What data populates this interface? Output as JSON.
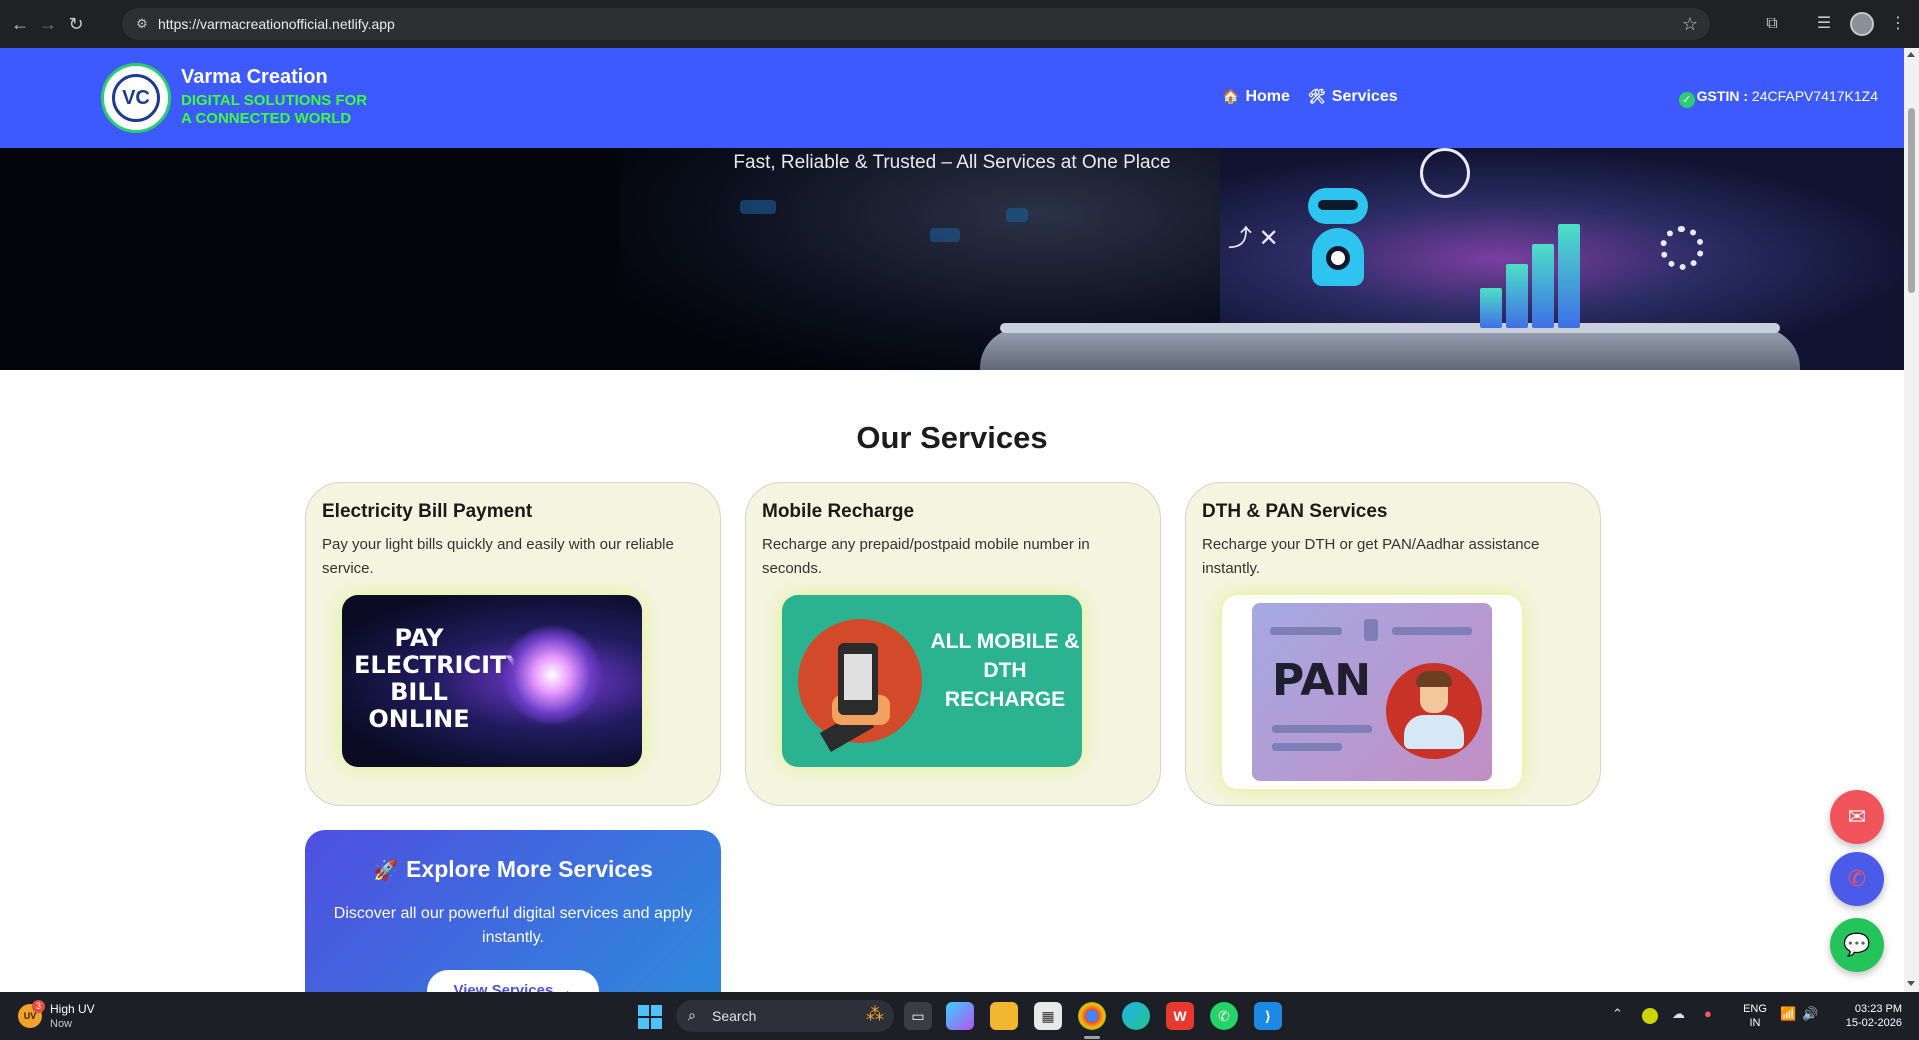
{
  "browser": {
    "url": "https://varmacreationofficial.netlify.app",
    "back_icon": "←",
    "forward_icon": "→",
    "reload_icon": "↻"
  },
  "header": {
    "logo_text": "VC",
    "brand_name": "Varma Creation",
    "tagline_line1": "DIGITAL SOLUTIONS FOR",
    "tagline_line2": "A CONNECTED WORLD",
    "nav": [
      {
        "label": "Home",
        "icon": "home-icon",
        "glyph": "🏠"
      },
      {
        "label": "Services",
        "icon": "tools-icon",
        "glyph": "🛠"
      }
    ],
    "gstin_label": "GSTIN :",
    "gstin_value": "24CFAPV7417K1Z4",
    "bg_color": "#3d5afe",
    "tagline_color": "#3dff3d"
  },
  "hero": {
    "tagline": "Fast, Reliable & Trusted – All Services at One Place"
  },
  "services": {
    "heading": "Our Services",
    "cards": [
      {
        "title": "Electricity Bill Payment",
        "description": "Pay your light bills quickly and easily with our reliable service.",
        "image_text": "PAY ELECTRICITY BILL ONLINE"
      },
      {
        "title": "Mobile Recharge",
        "description": "Recharge any prepaid/postpaid mobile number in seconds.",
        "image_text": "ALL MOBILE & DTH RECHARGE"
      },
      {
        "title": "DTH & PAN Services",
        "description": "Recharge your DTH or get PAN/Aadhar assistance instantly.",
        "image_text": "PAN"
      }
    ],
    "card_bg": "#f3f5df"
  },
  "explore": {
    "title": "Explore More Services",
    "rocket_glyph": "🚀",
    "subtitle": "Discover all our powerful digital services and apply instantly.",
    "button_label": "View Services →"
  },
  "fabs": [
    {
      "name": "email-fab",
      "icon": "mail-icon",
      "glyph": "✉",
      "color": "#f2545b"
    },
    {
      "name": "call-fab",
      "icon": "phone-icon",
      "glyph": "✆",
      "color": "#4a5bea"
    },
    {
      "name": "chat-fab",
      "icon": "chat-icon",
      "glyph": "💬",
      "color": "#25c45a"
    }
  ],
  "taskbar": {
    "weather_badge": "3",
    "weather_title": "High UV",
    "weather_sub": "Now",
    "weather_icon_text": "UV",
    "search_label": "Search",
    "lang_line1": "ENG",
    "lang_line2": "IN",
    "time": "03:23 PM",
    "date": "15-02-2026"
  }
}
